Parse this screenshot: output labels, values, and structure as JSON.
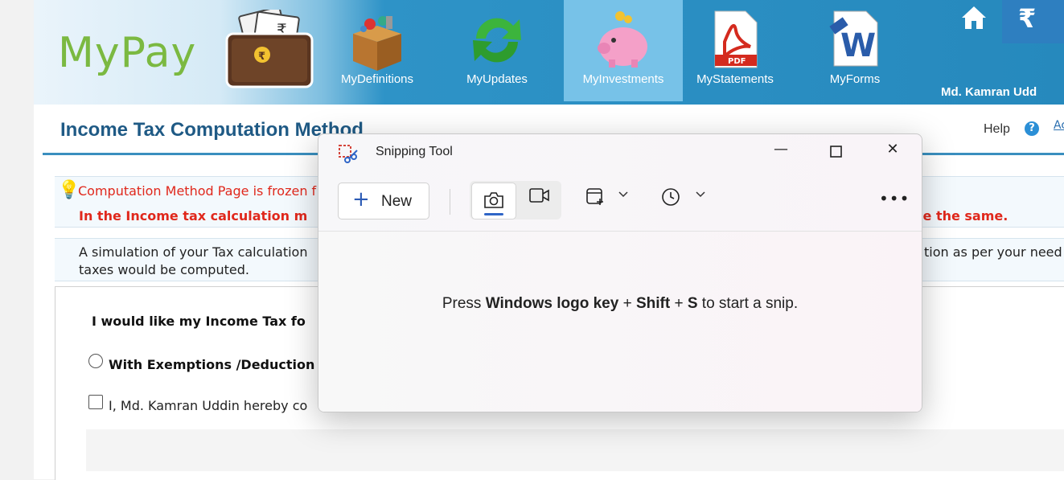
{
  "header": {
    "logo_text": "MyPay",
    "nav": [
      {
        "label": "MyDefinitions",
        "icon": "box-icon"
      },
      {
        "label": "MyUpdates",
        "icon": "refresh-icon"
      },
      {
        "label": "MyInvestments",
        "icon": "piggy-bank-icon",
        "active": true
      },
      {
        "label": "MyStatements",
        "icon": "pdf-icon"
      },
      {
        "label": "MyForms",
        "icon": "word-doc-icon"
      }
    ],
    "rupee_symbol": "₹",
    "user_name": "Md. Kamran Udd"
  },
  "page": {
    "title": "Income Tax Computation Method",
    "help_label": "Help",
    "help_icon_text": "?",
    "right_link": "Ac",
    "notice_frozen": "Computation Method Page is frozen f",
    "notice_bold": "In the Income tax calculation m",
    "notice_bold_end": "se the same.",
    "simulation_line1": "A simulation of your Tax calculation",
    "simulation_line1_end": "tion as per your need",
    "simulation_line2": "taxes would be computed.",
    "question": "I would like my Income Tax fo",
    "option_exemptions": "With Exemptions /Deduction",
    "consent_text": "I, Md. Kamran Uddin  hereby co"
  },
  "snipping_tool": {
    "title": "Snipping Tool",
    "new_label": "New",
    "new_plus": "+",
    "message_pre": "Press ",
    "message_key1": "Windows logo key",
    "message_plus1": " + ",
    "message_key2": "Shift",
    "message_plus2": " + ",
    "message_key3": "S",
    "message_post": " to start a snip.",
    "more_label": "•••",
    "minimize": "—",
    "close": "✕"
  }
}
